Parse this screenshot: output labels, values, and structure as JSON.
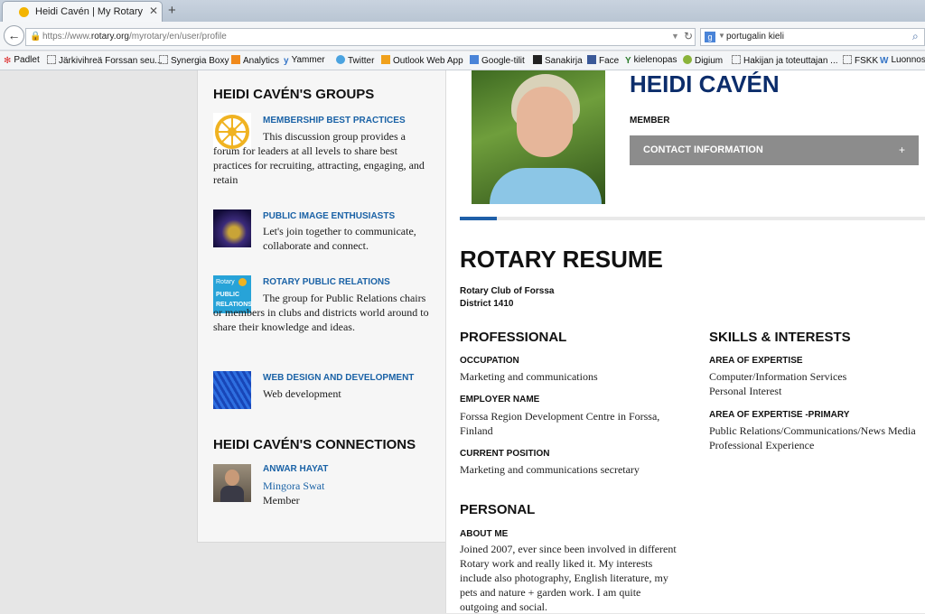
{
  "browser": {
    "tab_title": "Heidi Cavén | My Rotary",
    "url_prefix": "https://www.",
    "url_domain": "rotary.org",
    "url_path": "/myrotary/en/user/profile",
    "search_text": "portugalin kieli",
    "search_engine_icon": "g",
    "bookmarks": [
      "Padlet",
      "Järkivihreä Forssan seu...",
      "Synergia Boxy",
      "Analytics",
      "Yammer",
      "Twitter",
      "Outlook Web App",
      "Google-tilit",
      "Sanakirja",
      "Face",
      "kielenopas",
      "Digium",
      "Hakijan ja toteuttajan ...",
      "FSKK",
      "Luonnos"
    ]
  },
  "sidebar": {
    "groups_title": "HEIDI CAVÉN'S GROUPS",
    "groups": [
      {
        "name": "MEMBERSHIP BEST PRACTICES",
        "desc": "This discussion group provides a forum for leaders at all levels to share best practices for recruiting, attracting, engaging, and retain"
      },
      {
        "name": "PUBLIC IMAGE ENTHUSIASTS",
        "desc": "Let's join together to communicate, collaborate and connect."
      },
      {
        "name": "ROTARY PUBLIC RELATIONS",
        "desc": "The group for Public Relations chairs or members in clubs and districts world around to share their knowledge and ideas.",
        "thumb_text": [
          "Rotary",
          "PUBLIC",
          "RELATIONS"
        ]
      },
      {
        "name": "WEB DESIGN AND DEVELOPMENT",
        "desc": "Web development"
      }
    ],
    "connections_title": "HEIDI CAVÉN'S CONNECTIONS",
    "connection": {
      "name": "ANWAR HAYAT",
      "club": "Mingora Swat",
      "role": "Member"
    }
  },
  "profile": {
    "name": "HEIDI CAVÉN",
    "role": "MEMBER",
    "contact_label": "CONTACT INFORMATION",
    "contact_toggle": "+",
    "resume_title": "ROTARY RESUME",
    "club": "Rotary Club of Forssa",
    "district": "District 1410",
    "professional": {
      "title": "PROFESSIONAL",
      "occupation_label": "OCCUPATION",
      "occupation": "Marketing and communications",
      "employer_label": "EMPLOYER NAME",
      "employer": "Forssa Region Development Centre in Forssa, Finland",
      "position_label": "CURRENT POSITION",
      "position": "Marketing and communications secretary"
    },
    "skills": {
      "title": "SKILLS & INTERESTS",
      "expertise_label": "AREA OF EXPERTISE",
      "expertise_1": "Computer/Information Services",
      "expertise_2": "Personal Interest",
      "primary_label": "AREA OF EXPERTISE -PRIMARY",
      "primary_1": "Public Relations/Communications/News Media",
      "primary_2": "Professional Experience"
    },
    "personal": {
      "title": "PERSONAL",
      "about_label": "ABOUT ME",
      "about": "Joined 2007, ever since been involved in different Rotary work and really liked it. My interests include also photography, English literature, my pets and nature + garden work. I am quite outgoing and social."
    }
  },
  "colors": {
    "link": "#1a62a6",
    "heading": "#0c2d6b",
    "accent_bar": "#1f5fa8",
    "contact_bar": "#8c8c8c"
  }
}
